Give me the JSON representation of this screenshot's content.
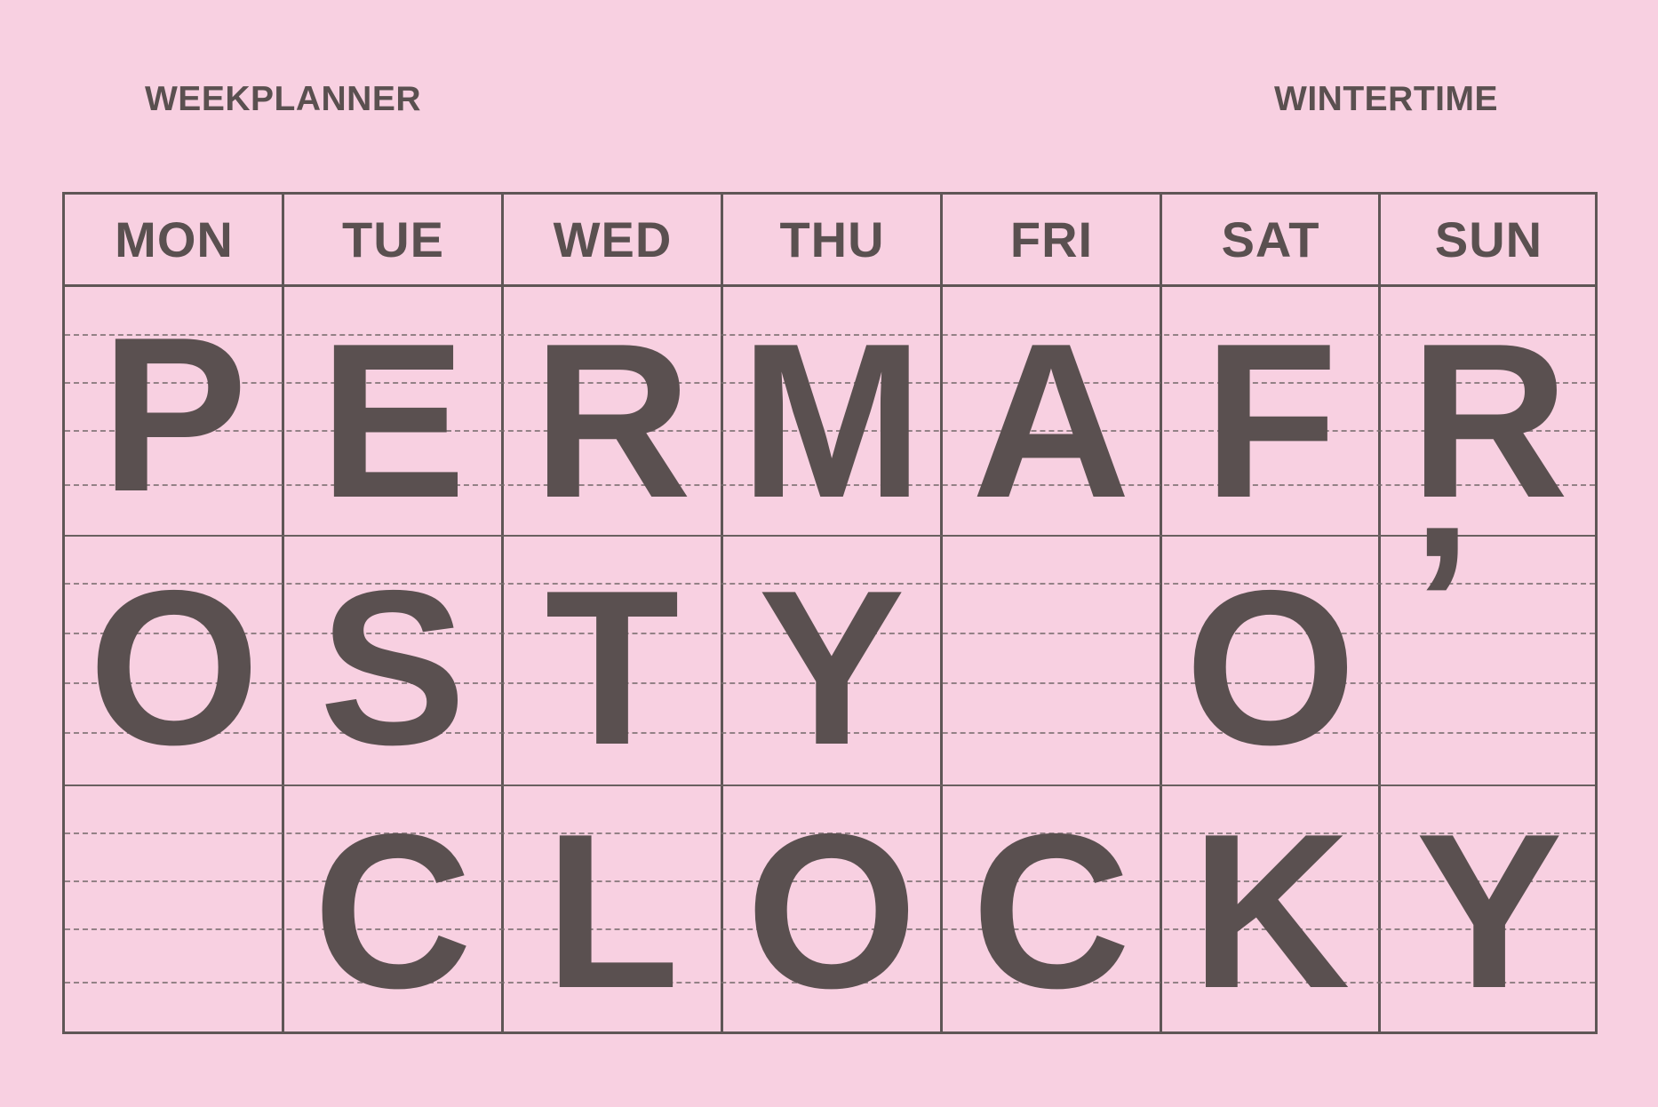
{
  "header": {
    "left_label": "WEEKPLANNER",
    "right_label": "WINTERTIME"
  },
  "days": [
    "MON",
    "TUE",
    "WED",
    "THU",
    "FRI",
    "SAT",
    "SUN"
  ],
  "rows": [
    [
      "P",
      "E",
      "R",
      "M",
      "A",
      "F",
      "R"
    ],
    [
      "O",
      "S",
      "T",
      "Y",
      "",
      "O",
      "’"
    ],
    [
      "",
      "C",
      "L",
      "O",
      "C",
      "K",
      "Y"
    ]
  ],
  "colors": {
    "paper": "#f8d0e1",
    "ink": "#5a5050"
  }
}
